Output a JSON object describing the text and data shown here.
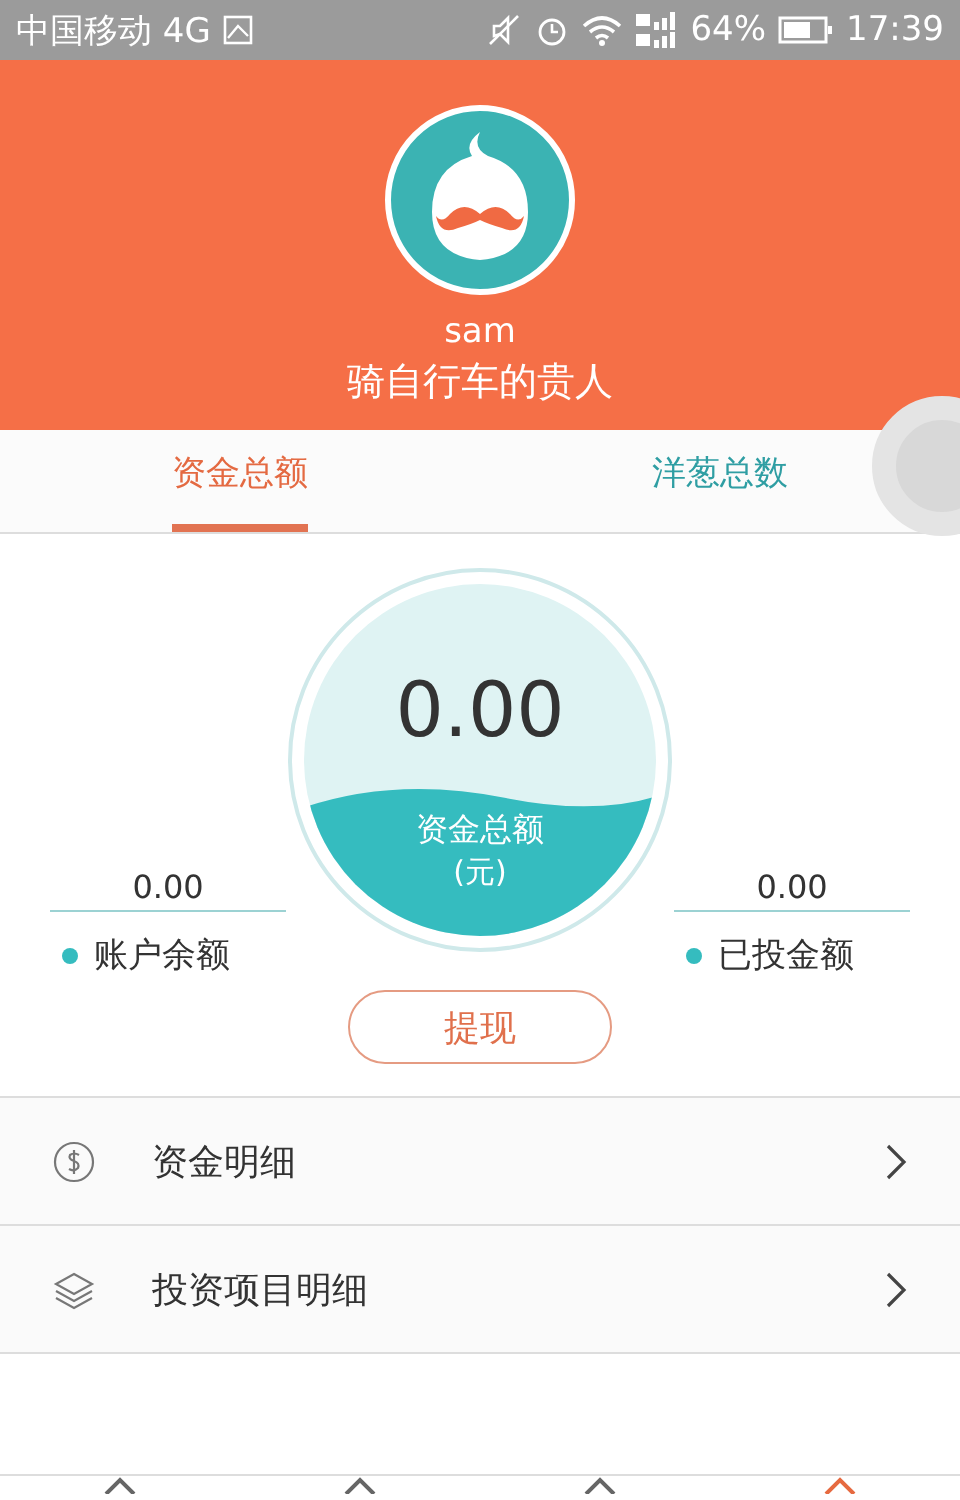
{
  "status_bar": {
    "carrier": "中国移动 4G",
    "battery": "64%",
    "time": "17:39"
  },
  "profile": {
    "name": "sam",
    "title": "骑自行车的贵人"
  },
  "tabs": [
    {
      "label": "资金总额",
      "selected": true
    },
    {
      "label": "洋葱总数",
      "selected": false
    }
  ],
  "gauge": {
    "value": "0.00",
    "label": "资金总额",
    "unit": "(元)"
  },
  "side_values": [
    {
      "value": "0.00",
      "label": "账户余额",
      "color": "#35bcbf"
    },
    {
      "value": "0.00",
      "label": "已投金额",
      "color": "#35bcbf"
    }
  ],
  "withdraw_button": "提现",
  "menu": [
    {
      "kind": "money",
      "label": "资金明细"
    },
    {
      "kind": "layers",
      "label": "投资项目明细"
    }
  ],
  "bottom_nav": [
    {
      "selected": false
    },
    {
      "selected": false
    },
    {
      "selected": false
    },
    {
      "selected": true
    }
  ]
}
